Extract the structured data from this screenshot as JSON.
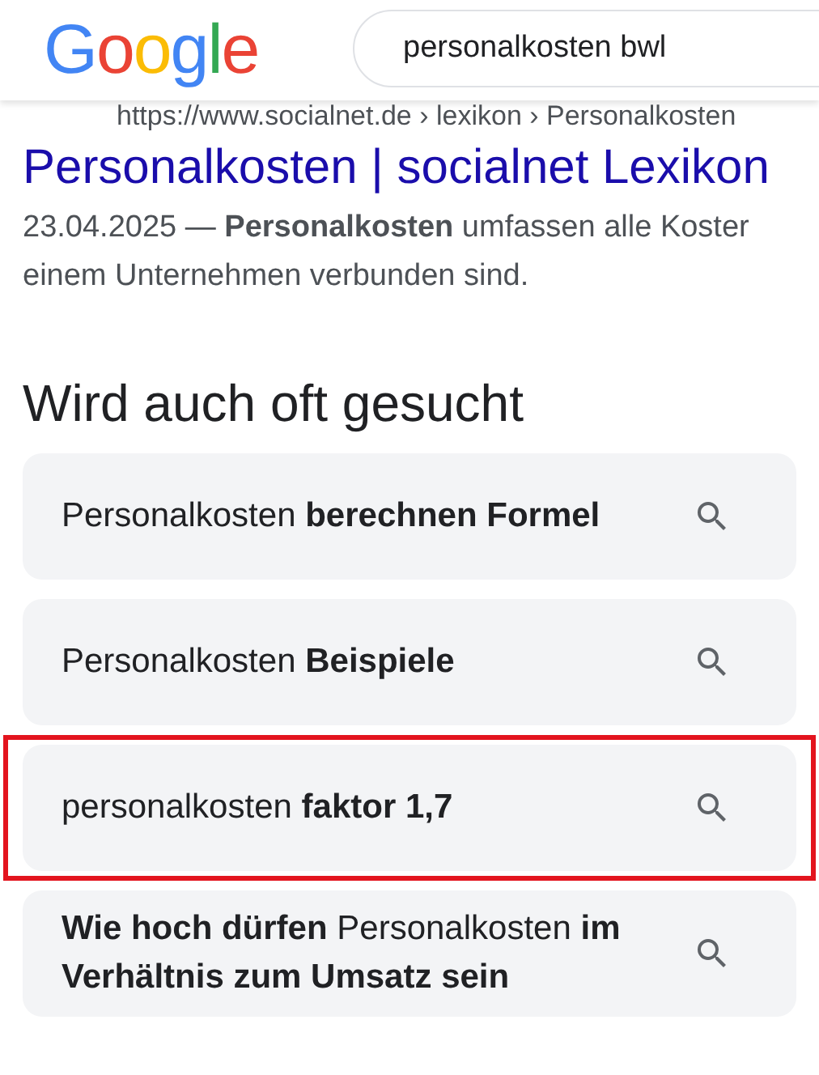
{
  "header": {
    "logo_letters": [
      {
        "char": "G",
        "color": "#4285f4"
      },
      {
        "char": "o",
        "color": "#ea4335"
      },
      {
        "char": "o",
        "color": "#fbbc05"
      },
      {
        "char": "g",
        "color": "#4285f4"
      },
      {
        "char": "l",
        "color": "#34a853"
      },
      {
        "char": "e",
        "color": "#ea4335"
      }
    ],
    "search": {
      "value": "personalkosten bwl"
    }
  },
  "result": {
    "url": "https://www.socialnet.de › lexikon › Personalkosten",
    "title": "Personalkosten | socialnet Lexikon",
    "snippet_lines": [
      "23.04.2025 — **Personalkosten** umfassen alle Koster",
      "einem Unternehmen verbunden sind."
    ]
  },
  "related": {
    "heading": "Wird auch oft gesucht",
    "items": [
      {
        "text": "Personalkosten **berechnen Formel**",
        "highlighted": false
      },
      {
        "text": "Personalkosten **Beispiele**",
        "highlighted": false
      },
      {
        "text": "personalkosten **faktor 1,7**",
        "highlighted": true
      },
      {
        "text": "**Wie hoch dürfen** Personalkosten **im Verhältnis zum Umsatz sein**",
        "highlighted": false
      }
    ]
  }
}
